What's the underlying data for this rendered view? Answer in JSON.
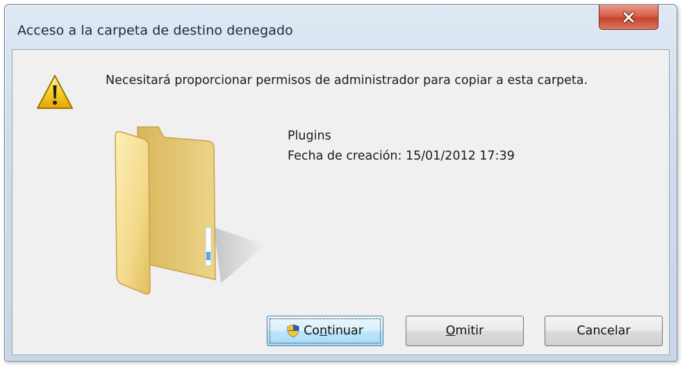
{
  "window": {
    "title": "Acceso a la carpeta de destino denegado",
    "close_icon": "close-icon"
  },
  "dialog": {
    "warning_icon": "warning-icon",
    "message": "Necesitará proporcionar permisos de administrador para copiar a esta carpeta.",
    "folder_icon": "folder-icon",
    "folder_name": "Plugins",
    "creation_date": "Fecha de creación: 15/01/2012 17:39"
  },
  "buttons": {
    "continue_pre": "Co",
    "continue_mnemonic": "n",
    "continue_post": "tinuar",
    "continue_icon": "uac-shield-icon",
    "omit_mnemonic": "O",
    "omit_post": "mitir",
    "cancel_label": "Cancelar"
  },
  "colors": {
    "close_button": "#c7432c",
    "default_button_border": "#3c7fb1",
    "client_background": "#f0f0f0"
  }
}
